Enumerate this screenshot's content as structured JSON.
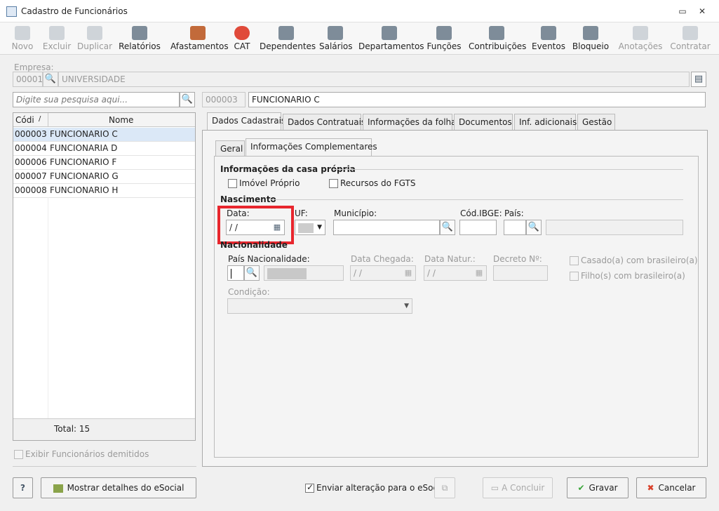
{
  "window": {
    "title": "Cadastro de Funcionários"
  },
  "toolbar": [
    {
      "label": "Novo",
      "icon": "new-icon",
      "enabled": false
    },
    {
      "label": "Excluir",
      "icon": "trash-icon",
      "enabled": false
    },
    {
      "label": "Duplicar",
      "icon": "duplicate-icon",
      "enabled": false
    },
    {
      "label": "Relatórios",
      "icon": "report-icon",
      "enabled": true
    },
    {
      "label": "Afastamentos",
      "icon": "house-icon",
      "enabled": true
    },
    {
      "label": "CAT",
      "icon": "medical-cross-icon",
      "enabled": true
    },
    {
      "label": "Dependentes",
      "icon": "people-icon",
      "enabled": true
    },
    {
      "label": "Salários",
      "icon": "money-icon",
      "enabled": true
    },
    {
      "label": "Departamentos",
      "icon": "desk-icon",
      "enabled": true
    },
    {
      "label": "Funções",
      "icon": "badge-icon",
      "enabled": true
    },
    {
      "label": "Contribuições",
      "icon": "contributions-icon",
      "enabled": true
    },
    {
      "label": "Eventos",
      "icon": "list-icon",
      "enabled": true
    },
    {
      "label": "Bloqueio",
      "icon": "lock-icon",
      "enabled": true
    },
    {
      "label": "Anotações",
      "icon": "notes-icon",
      "enabled": false
    },
    {
      "label": "Contratar",
      "icon": "hire-icon",
      "enabled": false
    }
  ],
  "empresa": {
    "label": "Empresa:",
    "code": "00001",
    "name": "UNIVERSIDADE"
  },
  "search": {
    "placeholder": "Digite sua pesquisa aqui..."
  },
  "funcionario": {
    "code": "000003",
    "name": "FUNCIONARIO C"
  },
  "grid": {
    "col_code": "Códi",
    "col_name": "Nome",
    "rows": [
      {
        "code": "000003",
        "name": "FUNCIONARIO C"
      },
      {
        "code": "000004",
        "name": "FUNCIONARIA D"
      },
      {
        "code": "000006",
        "name": "FUNCIONARIO F"
      },
      {
        "code": "000007",
        "name": "FUNCIONARIO G"
      },
      {
        "code": "000008",
        "name": "FUNCIONARIO H"
      }
    ],
    "total": "Total: 15"
  },
  "show_dismissed": "Exibir Funcionários demitidos",
  "tabs": [
    "Dados Cadastrais",
    "Dados Contratuais",
    "Informações da folha",
    "Documentos",
    "Inf. adicionais",
    "Gestão"
  ],
  "subtabs": [
    "Geral",
    "Informações Complementares"
  ],
  "casa": {
    "title": "Informações da casa própria",
    "imovel": "Imóvel Próprio",
    "fgts": "Recursos do FGTS"
  },
  "nascimento": {
    "title": "Nascimento",
    "data_label": "Data:",
    "data_value": "/ /",
    "uf_label": "UF:",
    "municipio_label": "Município:",
    "ibge_label": "Cód.IBGE:",
    "pais_label": "País:"
  },
  "nacionalidade": {
    "title": "Nacionalidade",
    "pais_label": "País Nacionalidade:",
    "chegada_label": "Data Chegada:",
    "chegada_value": "/ /",
    "natur_label": "Data Natur.:",
    "natur_value": "/ /",
    "decreto_label": "Decreto Nº:",
    "casado": "Casado(a) com brasileiro(a)",
    "filho": "Filho(s) com brasileiro(a)",
    "condicao_label": "Condição:"
  },
  "footer": {
    "help": "?",
    "esocial_details": "Mostrar detalhes do eSocial",
    "send_change": "Enviar alteração para o eSocial",
    "concluir": "A Concluir",
    "gravar": "Gravar",
    "cancelar": "Cancelar"
  },
  "colors": {
    "highlight": "#e8262d",
    "selected_row": "#dbe8f7",
    "ok_green": "#3aa53a",
    "cancel_red": "#d9412b"
  }
}
